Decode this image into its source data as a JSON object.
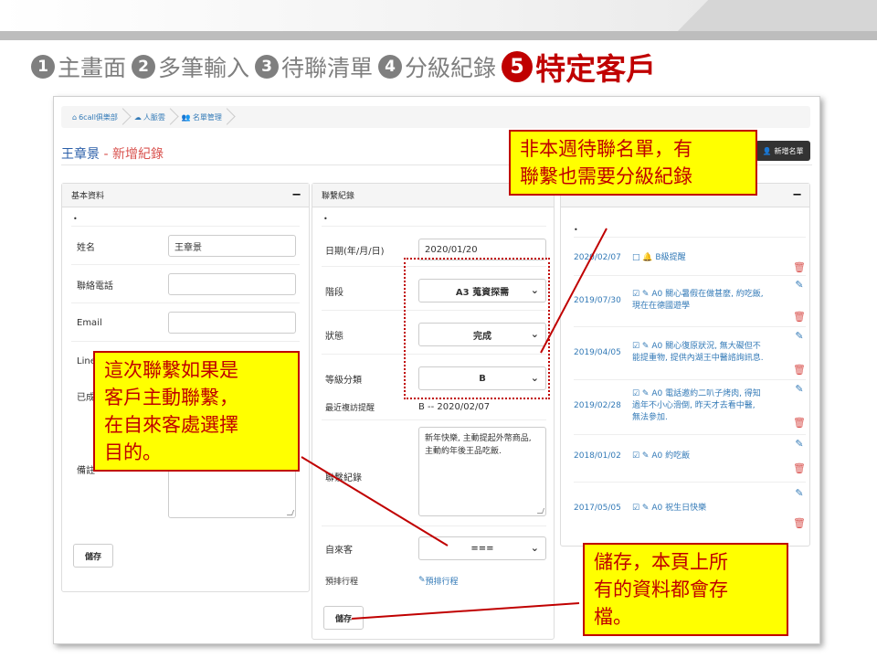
{
  "slide": {
    "steps": [
      {
        "num": "1",
        "label": "主畫面"
      },
      {
        "num": "2",
        "label": "多筆輸入"
      },
      {
        "num": "3",
        "label": "待聯清單"
      },
      {
        "num": "4",
        "label": "分級紀錄"
      },
      {
        "num": "5",
        "label": "特定客戶"
      }
    ]
  },
  "breadcrumb": [
    "6call俱樂部",
    "人脈雲",
    "名單管理"
  ],
  "heading": {
    "name": "王章景",
    "sep": " - ",
    "action": "新增紀錄"
  },
  "new_list_button": "新增名單",
  "basic_panel": {
    "title": "基本資料",
    "collapse": "−",
    "dot": "•",
    "fields": {
      "name_label": "姓名",
      "name_value": "王章景",
      "phone_label": "聯絡電話",
      "email_label": "Email",
      "line_label": "Line",
      "joined_label": "已成",
      "note_label": "備註"
    },
    "save": "儲存"
  },
  "contact_panel": {
    "title": "聯繫紀錄",
    "dot": "•",
    "date_label": "日期(年/月/日)",
    "date_value": "2020/01/20",
    "stage_label": "階段",
    "stage_value": "A3 蒐資探需",
    "status_label": "狀態",
    "status_value": "完成",
    "grade_label": "等級分類",
    "grade_value": "B",
    "reminder_label": "最近複訪提醒",
    "reminder_value": "B -- 2020/02/07",
    "record_label": "聯繫紀錄",
    "record_value": "新年快樂, 主動提起外幣商品, 主動約年後王品吃飯.",
    "source_label": "自來客",
    "source_value": "===",
    "schedule_label": "預排行程",
    "schedule_link": "預排行程",
    "save": "儲存"
  },
  "history_panel": {
    "collapse": "−",
    "dot": "•",
    "rows": [
      {
        "date": "2020/02/07",
        "text": "□ 🔔 B級提醒"
      },
      {
        "date": "2019/07/30",
        "text": "☑ ✎ A0 關心暑假在做甚麼, 約吃飯, 現在在德國遊學"
      },
      {
        "date": "2019/04/05",
        "text": "☑ ✎ A0 關心復原狀況, 無大礙但不能提重物, 提供內湖王中醫諮詢訊息."
      },
      {
        "date": "2019/02/28",
        "text": "☑ ✎ A0 電話邀約二叭子烤肉, 得知過年不小心滑倒, 昨天才去看中醫, 無法參加."
      },
      {
        "date": "2018/01/02",
        "text": "☑ ✎ A0 約吃飯"
      },
      {
        "date": "2017/05/05",
        "text": "☑ ✎ A0 祝生日快樂"
      }
    ]
  },
  "callouts": {
    "top": [
      "非本週待聯名單，有",
      "聯繫也需要分級紀錄"
    ],
    "left": [
      "這次聯繫如果是",
      "客戶主動聯繫，",
      "在自來客處選擇",
      "目的。"
    ],
    "bottom": [
      "儲存，本頁上所",
      "有的資料都會存",
      "檔。"
    ]
  },
  "colors": {
    "accent": "#c00000",
    "callout_bg": "#ffff00",
    "link": "#337ab7",
    "heading": "#2a5ea8"
  }
}
